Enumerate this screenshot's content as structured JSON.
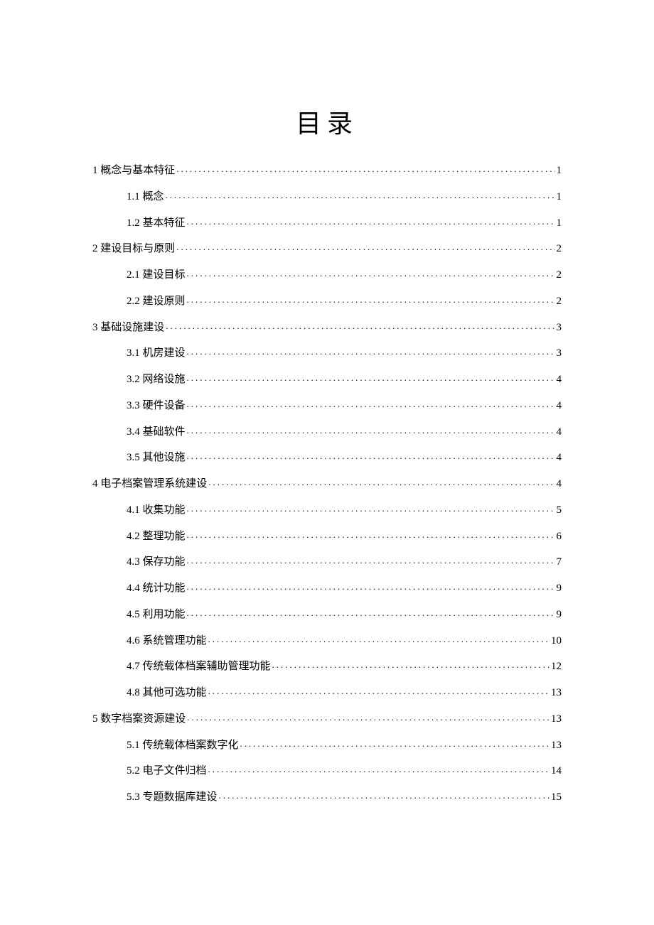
{
  "title": "目录",
  "entries": [
    {
      "level": 1,
      "label": "1 概念与基本特征",
      "page": "1"
    },
    {
      "level": 2,
      "label": "1.1  概念",
      "page": "1"
    },
    {
      "level": 2,
      "label": "1.2  基本特征",
      "page": "1"
    },
    {
      "level": 1,
      "label": "2 建设目标与原则",
      "page": "2"
    },
    {
      "level": 2,
      "label": "2.1  建设目标",
      "page": "2"
    },
    {
      "level": 2,
      "label": "2.2  建设原则",
      "page": "2"
    },
    {
      "level": 1,
      "label": "3 基础设施建设",
      "page": "3"
    },
    {
      "level": 2,
      "label": "3.1 机房建设",
      "page": "3"
    },
    {
      "level": 2,
      "label": "3.2 网络设施",
      "page": "4"
    },
    {
      "level": 2,
      "label": "3.3 硬件设备",
      "page": "4"
    },
    {
      "level": 2,
      "label": "3.4 基础软件",
      "page": "4"
    },
    {
      "level": 2,
      "label": "3.5 其他设施",
      "page": "4"
    },
    {
      "level": 1,
      "label": "4  电子档案管理系统建设",
      "page": "4"
    },
    {
      "level": 2,
      "label": "4.1 收集功能",
      "page": "5"
    },
    {
      "level": 2,
      "label": "4.2 整理功能",
      "page": "6"
    },
    {
      "level": 2,
      "label": "4.3 保存功能",
      "page": "7"
    },
    {
      "level": 2,
      "label": "4.4 统计功能",
      "page": "9"
    },
    {
      "level": 2,
      "label": "4.5 利用功能",
      "page": "9"
    },
    {
      "level": 2,
      "label": "4.6 系统管理功能",
      "page": "10"
    },
    {
      "level": 2,
      "label": "4.7 传统载体档案辅助管理功能",
      "page": "12"
    },
    {
      "level": 2,
      "label": "4.8 其他可选功能",
      "page": "13"
    },
    {
      "level": 1,
      "label": "5  数字档案资源建设",
      "page": "13"
    },
    {
      "level": 2,
      "label": "5.1 传统载体档案数字化",
      "page": "13"
    },
    {
      "level": 2,
      "label": "5.2 电子文件归档",
      "page": "14"
    },
    {
      "level": 2,
      "label": "5.3 专题数据库建设",
      "page": "15"
    }
  ]
}
